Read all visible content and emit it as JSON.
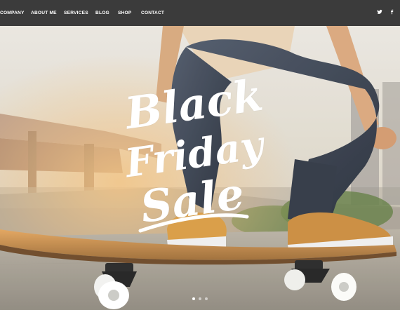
{
  "nav": {
    "items": [
      {
        "label": "COMPANY"
      },
      {
        "label": "ABOUT ME"
      },
      {
        "label": "SERVICES"
      },
      {
        "label": "BLOG"
      },
      {
        "label": "SHOP"
      },
      {
        "label": "CONTACT"
      }
    ]
  },
  "social": {
    "twitter_icon": "twitter-icon",
    "facebook_icon": "facebook-icon"
  },
  "hero": {
    "headline_line1": "Black",
    "headline_line2": "Friday",
    "headline_line3": "Sale",
    "slides_total": 3,
    "active_slide": 1
  },
  "colors": {
    "topbar": "#3b3b3b",
    "text": "#ffffff"
  }
}
